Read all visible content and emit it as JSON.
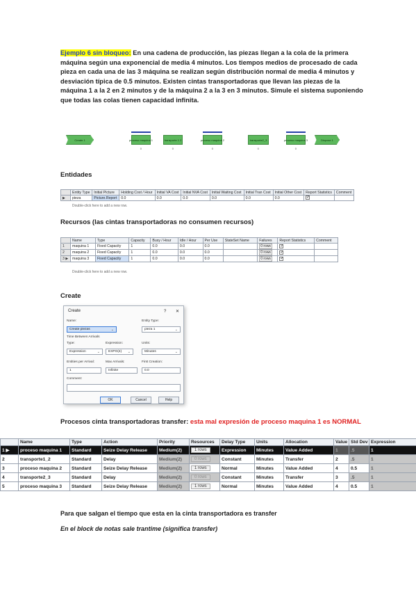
{
  "exercise": {
    "title": "Ejemplo 6 sin bloqueo:",
    "body": " En una cadena de producción, las piezas llegan a la cola de la primera máquina según una exponencial de media 4 minutos. Los tiempos medios de procesado de cada pieza en cada una de las 3 máquina se realizan según distribución normal de media 4 minutos y desviación típica de 0.5 minutos. Existen cintas transportadoras que llevan las piezas de la máquina 1 a la 2 en 2 minutos y de la máquina 2 a la 3 en 3 minutos. Simule el sistema suponiendo que todas las colas tienen capacidad infinita."
  },
  "flowchart": {
    "blocks": [
      "Create 1",
      "proceso maquina 1",
      "transporte 1 2",
      "proceso maquina 2",
      "transporte2_3",
      "proceso maquina 3",
      "Dispose 1"
    ],
    "counts": [
      "0",
      "0",
      "0",
      "0",
      "0",
      "0",
      "0"
    ]
  },
  "sections": {
    "entidades": "Entidades",
    "recursos": "Recursos (las cintas transportadoras no consumen recursos)",
    "create": "Create",
    "procesos_prefix": "Procesos cinta transportadoras transfer: ",
    "procesos_red": "esta mal expresión de proceso maquina 1 es NORMAL"
  },
  "entity_table": {
    "headers": [
      "Entity Type",
      "Initial Picture",
      "Holding Cost / Hour",
      "Initial VA Cost",
      "Initial NVA Cost",
      "Initial Waiting Cost",
      "Initial Tran Cost",
      "Initial Other Cost",
      "Report Statistics",
      "Comment"
    ],
    "rows": [
      [
        "pieza",
        "Picture.Report",
        "0.0",
        "0.0",
        "0.0",
        "0.0",
        "0.0",
        "0.0",
        "",
        ""
      ]
    ],
    "footer": "Double-click here to add a new row."
  },
  "resource_table": {
    "headers": [
      "Name",
      "Type",
      "Capacity",
      "Busy / Hour",
      "Idle / Hour",
      "Per Use",
      "StateSet Name",
      "Failures",
      "Report Statistics",
      "Comment"
    ],
    "rows": [
      [
        "1",
        "maquina 1",
        "Fixed Capacity",
        "1",
        "0.0",
        "0.0",
        "0.0",
        "",
        "0 rows",
        ""
      ],
      [
        "2",
        "maquina 2",
        "Fixed Capacity",
        "1",
        "0.0",
        "0.0",
        "0.0",
        "",
        "0 rows",
        ""
      ],
      [
        "3",
        "maquina 3",
        "Fixed Capacity",
        "1",
        "0.0",
        "0.0",
        "0.0",
        "",
        "0 rows",
        ""
      ]
    ],
    "footer": "Double-click here to add a new row."
  },
  "create_dialog": {
    "title": "Create",
    "help": "?",
    "close": "✕",
    "name_label": "Name:",
    "name_value": "Create piezas",
    "entity_type_label": "Entity Type:",
    "entity_type_value": "pieza 1",
    "time_between_label": "Time Between Arrivals",
    "type_label": "Type:",
    "type_value": "Expression",
    "value_label": "Expression:",
    "value_value": "EXPO(4)",
    "units_label": "Units:",
    "units_value": "Minutes",
    "entities_label": "Entities per Arrival:",
    "entities_value": "1",
    "max_label": "Max Arrivals:",
    "max_value": "Infinite",
    "first_label": "First Creation:",
    "first_value": "0.0",
    "comment_label": "Comment:",
    "comment_value": "",
    "ok": "OK",
    "cancel": "Cancel",
    "help_btn": "Help"
  },
  "process_table": {
    "headers": [
      "",
      "Name",
      "Type",
      "Action",
      "Priority",
      "Resources",
      "Delay Type",
      "Units",
      "Allocation",
      "Value",
      "Std Dev",
      "Expression"
    ],
    "rows": [
      [
        "1",
        "proceso maquina 1",
        "Standard",
        "Seize Delay Release",
        "Medium(2)",
        "1 rows",
        "Expression",
        "Minutes",
        "Value Added",
        "1",
        ".5",
        "1"
      ],
      [
        "2",
        "transporte1_2",
        "Standard",
        "Delay",
        "Medium(2)",
        "0 rows",
        "Constant",
        "Minutes",
        "Transfer",
        "2",
        ".5",
        "1"
      ],
      [
        "3",
        "proceso maquina 2",
        "Standard",
        "Seize Delay Release",
        "Medium(2)",
        "1 rows",
        "Normal",
        "Minutes",
        "Value Added",
        "4",
        "0.5",
        "1"
      ],
      [
        "4",
        "transporte2_3",
        "Standard",
        "Delay",
        "Medium(2)",
        "0 rows",
        "Constant",
        "Minutes",
        "Transfer",
        "3",
        ".5",
        "1"
      ],
      [
        "5",
        "proceso maquina 3",
        "Standard",
        "Seize Delay Release",
        "Medium(2)",
        "1 rows",
        "Normal",
        "Minutes",
        "Value Added",
        "4",
        "0.5",
        "1"
      ]
    ]
  },
  "footer_text": {
    "line1": "Para que salgan el tiempo que esta en la cinta transportadora es transfer",
    "line2": "En el block de notas sale trantime  (significa transfer)"
  },
  "colors": {
    "highlight": "#ffff00",
    "title_blue": "#1f3fbf",
    "red_note": "#e02020",
    "flow_green": "#5cb85c"
  }
}
